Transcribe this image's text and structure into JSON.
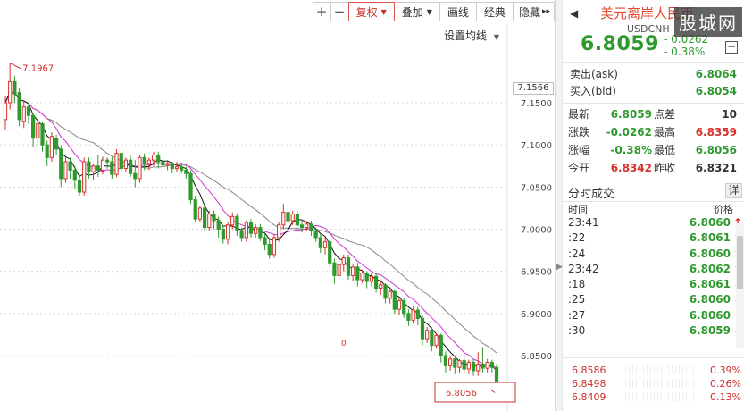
{
  "toolbar": {
    "plus": "+",
    "minus": "−",
    "fuquan": "复权",
    "diejia": "叠加",
    "huaxian": "画线",
    "jingdian": "经典",
    "yincang": "隐藏",
    "expand": "▸▸"
  },
  "ma_setting": "设置均线",
  "chart_data": {
    "type": "candlestick",
    "y_ticks": [
      "7.1500",
      "7.1000",
      "7.0500",
      "7.0000",
      "6.9500",
      "6.9000",
      "6.8500"
    ],
    "ylim": [
      6.81,
      7.21
    ],
    "current_price_label": "7.1566",
    "high_annotation": "7.1967",
    "low_annotation": "6.8056",
    "marker_text": "0",
    "candles": [
      [
        7.13,
        7.15,
        7.118,
        7.158
      ],
      [
        7.15,
        7.175,
        7.142,
        7.197
      ],
      [
        7.175,
        7.16,
        7.15,
        7.182
      ],
      [
        7.162,
        7.13,
        7.122,
        7.168
      ],
      [
        7.128,
        7.145,
        7.12,
        7.152
      ],
      [
        7.145,
        7.135,
        7.125,
        7.15
      ],
      [
        7.135,
        7.108,
        7.098,
        7.138
      ],
      [
        7.108,
        7.125,
        7.102,
        7.128
      ],
      [
        7.125,
        7.1,
        7.092,
        7.128
      ],
      [
        7.1,
        7.085,
        7.075,
        7.105
      ],
      [
        7.085,
        7.11,
        7.08,
        7.115
      ],
      [
        7.108,
        7.095,
        7.088,
        7.112
      ],
      [
        7.095,
        7.06,
        7.05,
        7.1
      ],
      [
        7.06,
        7.08,
        7.055,
        7.085
      ],
      [
        7.08,
        7.07,
        7.06,
        7.085
      ],
      [
        7.07,
        7.058,
        7.048,
        7.075
      ],
      [
        7.058,
        7.044,
        7.04,
        7.065
      ],
      [
        7.044,
        7.08,
        7.04,
        7.085
      ],
      [
        7.08,
        7.068,
        7.06,
        7.085
      ],
      [
        7.068,
        7.075,
        7.058,
        7.078
      ],
      [
        7.075,
        7.07,
        7.062,
        7.088
      ],
      [
        7.07,
        7.082,
        7.065,
        7.086
      ],
      [
        7.082,
        7.08,
        7.072,
        7.085
      ],
      [
        7.08,
        7.065,
        7.06,
        7.086
      ],
      [
        7.065,
        7.09,
        7.062,
        7.095
      ],
      [
        7.09,
        7.072,
        7.068,
        7.092
      ],
      [
        7.072,
        7.082,
        7.068,
        7.085
      ],
      [
        7.082,
        7.066,
        7.062,
        7.088
      ],
      [
        7.066,
        7.06,
        7.05,
        7.082
      ],
      [
        7.06,
        7.085,
        7.055,
        7.088
      ],
      [
        7.085,
        7.078,
        7.07,
        7.09
      ],
      [
        7.078,
        7.082,
        7.07,
        7.085
      ],
      [
        7.082,
        7.088,
        7.075,
        7.092
      ],
      [
        7.088,
        7.08,
        7.072,
        7.092
      ],
      [
        7.08,
        7.076,
        7.07,
        7.085
      ],
      [
        7.076,
        7.078,
        7.07,
        7.082
      ],
      [
        7.078,
        7.072,
        7.066,
        7.08
      ],
      [
        7.072,
        7.074,
        7.068,
        7.08
      ],
      [
        7.074,
        7.07,
        7.066,
        7.078
      ],
      [
        7.07,
        7.066,
        7.06,
        7.074
      ],
      [
        7.066,
        7.035,
        7.03,
        7.07
      ],
      [
        7.035,
        7.012,
        7.008,
        7.04
      ],
      [
        7.012,
        7.025,
        7.008,
        7.028
      ],
      [
        7.025,
        7.002,
        6.998,
        7.03
      ],
      [
        7.002,
        7.018,
        6.998,
        7.022
      ],
      [
        7.018,
        7.01,
        7.0,
        7.022
      ],
      [
        7.01,
        7.0,
        6.99,
        7.015
      ],
      [
        7.0,
        6.988,
        6.983,
        7.004
      ],
      [
        6.988,
        7.005,
        6.982,
        7.008
      ],
      [
        7.005,
        7.015,
        7.0,
        7.02
      ],
      [
        7.015,
        6.998,
        6.992,
        7.018
      ],
      [
        6.998,
        6.99,
        6.985,
        7.002
      ],
      [
        6.99,
        7.008,
        6.985,
        7.01
      ],
      [
        7.008,
        6.995,
        6.99,
        7.012
      ],
      [
        6.995,
        7.002,
        6.99,
        7.006
      ],
      [
        7.002,
        6.99,
        6.986,
        7.006
      ],
      [
        6.99,
        6.982,
        6.975,
        6.995
      ],
      [
        6.982,
        6.97,
        6.965,
        6.99
      ],
      [
        6.97,
        6.99,
        6.966,
        6.994
      ],
      [
        6.99,
        7.005,
        6.985,
        7.008
      ],
      [
        7.005,
        7.02,
        7.0,
        7.03
      ],
      [
        7.02,
        7.01,
        7.005,
        7.025
      ],
      [
        7.01,
        7.018,
        7.005,
        7.022
      ],
      [
        7.018,
        7.005,
        7.0,
        7.022
      ],
      [
        7.005,
        7.002,
        6.996,
        7.01
      ],
      [
        7.002,
        7.006,
        6.998,
        7.01
      ],
      [
        7.006,
        6.998,
        6.992,
        7.01
      ],
      [
        6.998,
        6.99,
        6.985,
        7.002
      ],
      [
        6.99,
        6.978,
        6.972,
        6.995
      ],
      [
        6.978,
        6.985,
        6.97,
        6.99
      ],
      [
        6.985,
        6.96,
        6.955,
        6.988
      ],
      [
        6.96,
        6.945,
        6.935,
        6.965
      ],
      [
        6.945,
        6.958,
        6.94,
        6.962
      ],
      [
        6.958,
        6.966,
        6.95,
        6.97
      ],
      [
        6.966,
        6.945,
        6.94,
        6.97
      ],
      [
        6.945,
        6.955,
        6.938,
        6.958
      ],
      [
        6.955,
        6.94,
        6.932,
        6.96
      ],
      [
        6.94,
        6.948,
        6.936,
        6.952
      ],
      [
        6.948,
        6.938,
        6.93,
        6.95
      ],
      [
        6.938,
        6.944,
        6.932,
        6.948
      ],
      [
        6.944,
        6.93,
        6.925,
        6.948
      ],
      [
        6.93,
        6.934,
        6.922,
        6.938
      ],
      [
        6.934,
        6.918,
        6.912,
        6.936
      ],
      [
        6.918,
        6.926,
        6.912,
        6.93
      ],
      [
        6.926,
        6.905,
        6.9,
        6.928
      ],
      [
        6.905,
        6.915,
        6.898,
        6.918
      ],
      [
        6.915,
        6.9,
        6.895,
        6.918
      ],
      [
        6.9,
        6.892,
        6.885,
        6.905
      ],
      [
        6.892,
        6.904,
        6.888,
        6.908
      ],
      [
        6.904,
        6.894,
        6.886,
        6.908
      ],
      [
        6.894,
        6.87,
        6.862,
        6.898
      ],
      [
        6.87,
        6.88,
        6.865,
        6.884
      ],
      [
        6.88,
        6.862,
        6.855,
        6.884
      ],
      [
        6.862,
        6.874,
        6.858,
        6.876
      ],
      [
        6.874,
        6.85,
        6.842,
        6.876
      ],
      [
        6.85,
        6.838,
        6.83,
        6.855
      ],
      [
        6.838,
        6.846,
        6.832,
        6.85
      ],
      [
        6.846,
        6.836,
        6.828,
        6.85
      ],
      [
        6.836,
        6.844,
        6.83,
        6.846
      ],
      [
        6.844,
        6.834,
        6.828,
        6.85
      ],
      [
        6.834,
        6.842,
        6.828,
        6.845
      ],
      [
        6.842,
        6.832,
        6.826,
        6.846
      ],
      [
        6.832,
        6.84,
        6.826,
        6.854
      ],
      [
        6.84,
        6.835,
        6.83,
        6.86
      ],
      [
        6.835,
        6.842,
        6.83,
        6.846
      ],
      [
        6.842,
        6.836,
        6.83,
        6.845
      ],
      [
        6.836,
        6.812,
        6.806,
        6.84
      ]
    ]
  },
  "header": {
    "back_arrow": "◀",
    "name": "美元离岸人民币",
    "code": "USDCNH",
    "price": "6.8059",
    "change": "- 0.0262",
    "change_pct": "- 0.38%",
    "min_btn": "−",
    "watermark": "股城网"
  },
  "bidask": [
    {
      "label": "卖出(ask)",
      "value": "6.8064"
    },
    {
      "label": "买入(bid)",
      "value": "6.8054"
    }
  ],
  "stats": [
    {
      "l1": "最新",
      "v1": "6.8059",
      "c1": "green",
      "l2": "点差",
      "v2": "10",
      "c2": "dark"
    },
    {
      "l1": "涨跌",
      "v1": "-0.0262",
      "c1": "green",
      "l2": "最高",
      "v2": "6.8359",
      "c2": "red"
    },
    {
      "l1": "涨幅",
      "v1": "-0.38%",
      "c1": "green",
      "l2": "最低",
      "v2": "6.8056",
      "c2": "green"
    },
    {
      "l1": "今开",
      "v1": "6.8342",
      "c1": "red",
      "l2": "昨收",
      "v2": "6.8321",
      "c2": "dark"
    }
  ],
  "ticks_title": "分时成交",
  "ticks_detail_btn": "详",
  "ticks_col_time": "时间",
  "ticks_col_price": "价格",
  "ticks": [
    {
      "time": "23:41",
      "price": "6.8060",
      "dir": "↑",
      "up": true
    },
    {
      "time": ":22",
      "price": "6.8061",
      "dir": "↑",
      "up": true
    },
    {
      "time": ":24",
      "price": "6.8060",
      "dir": "↑",
      "up": true
    },
    {
      "time": "23:42",
      "price": "6.8062",
      "dir": "↑",
      "up": true
    },
    {
      "time": ":18",
      "price": "6.8061",
      "dir": "↓",
      "up": false
    },
    {
      "time": ":25",
      "price": "6.8060",
      "dir": "↓",
      "up": false
    },
    {
      "time": ":27",
      "price": "6.8060",
      "dir": "",
      "up": false
    },
    {
      "time": ":30",
      "price": "6.8059",
      "dir": "↓",
      "up": false
    }
  ],
  "depth": [
    {
      "price": "6.8586",
      "pct": "0.39%"
    },
    {
      "price": "6.8498",
      "pct": "0.26%"
    },
    {
      "price": "6.8409",
      "pct": "0.13%"
    }
  ],
  "colors": {
    "up": "#d9302a",
    "down": "#2e9a2e",
    "ma5": "#111111",
    "ma10": "#cc33cc",
    "ma20": "#888888"
  }
}
